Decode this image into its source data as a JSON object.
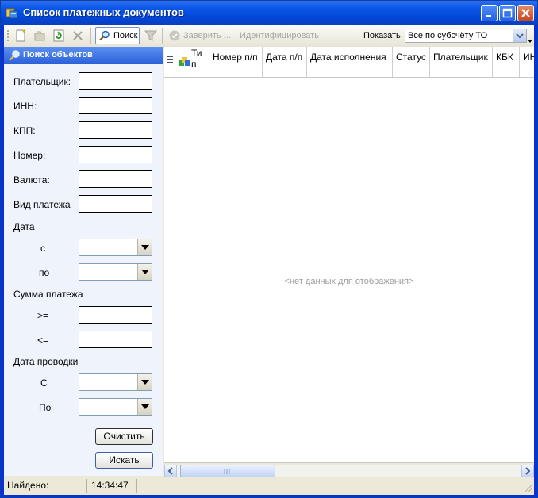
{
  "window": {
    "title": "Список платежных документов"
  },
  "toolbar": {
    "search_label": "Поиск",
    "certify_label": "Заверить ...",
    "identify_label": "Идентифицировать",
    "show_label": "Показать",
    "show_value": "Все по субсчёту ТО"
  },
  "search_panel": {
    "header": "Поиск объектов",
    "fields": {
      "payer": "Плательщик:",
      "inn": "ИНН:",
      "kpp": "КПП:",
      "number": "Номер:",
      "currency": "Валюта:",
      "payment_type": "Вид платежа"
    },
    "date_group": "Дата",
    "date_from": "с",
    "date_to": "по",
    "amount_group": "Сумма платежа",
    "amount_gte": ">=",
    "amount_lte": "<=",
    "posting_date_group": "Дата проводки",
    "posting_from": "С",
    "posting_to": "По",
    "clear_button": "Очистить",
    "search_button": "Искать"
  },
  "grid": {
    "columns": [
      "Ти\nп",
      "Номер п/п",
      "Дата п/п",
      "Дата исполнения",
      "Статус",
      "Плательщик",
      "КБК",
      "ИНН"
    ],
    "empty_text": "<нет данных для отображения>"
  },
  "status_bar": {
    "found_label": "Найдено:",
    "time": "14:34:47"
  },
  "colors": {
    "title_bar": "#0a57e8",
    "panel_header": "#2a61d8",
    "panel_bg": "#eef3fc",
    "window_bg": "#ece9d8"
  }
}
